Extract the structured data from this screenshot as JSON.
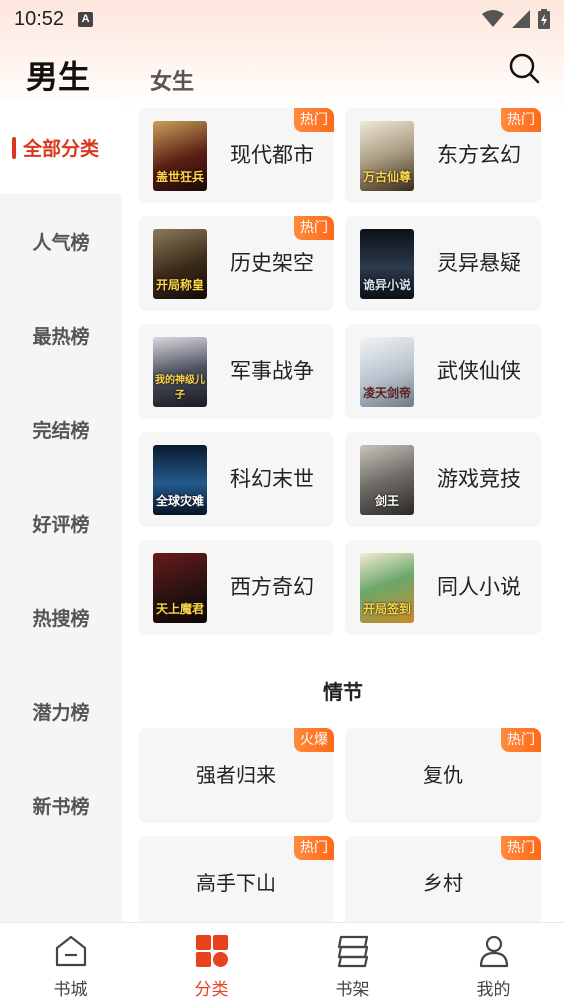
{
  "status_bar": {
    "time": "10:52",
    "notification_letter": "A"
  },
  "header": {
    "tab_male": "男生",
    "tab_female": "女生"
  },
  "sidebar": {
    "items": [
      {
        "label": "全部分类",
        "active": true
      },
      {
        "label": "人气榜"
      },
      {
        "label": "最热榜"
      },
      {
        "label": "完结榜"
      },
      {
        "label": "好评榜"
      },
      {
        "label": "热搜榜"
      },
      {
        "label": "潜力榜"
      },
      {
        "label": "新书榜"
      }
    ]
  },
  "genres": [
    {
      "title": "现代都市",
      "badge": "热门",
      "cover_text": "盖世狂兵",
      "cover_color": "#5a1e14"
    },
    {
      "title": "东方玄幻",
      "badge": "热门",
      "cover_text": "万古仙尊",
      "cover_color": "#c9c2b0"
    },
    {
      "title": "历史架空",
      "badge": "热门",
      "cover_text": "开局称皇",
      "cover_color": "#3a2a1a"
    },
    {
      "title": "灵异悬疑",
      "badge": "",
      "cover_text": "诡异小说",
      "cover_color": "#1f2630"
    },
    {
      "title": "军事战争",
      "badge": "",
      "cover_text": "我的神级儿子",
      "cover_color": "#2e2f3a"
    },
    {
      "title": "武侠仙侠",
      "badge": "",
      "cover_text": "凌天剑帝",
      "cover_color": "#d8dde2"
    },
    {
      "title": "科幻末世",
      "badge": "",
      "cover_text": "全球灾难",
      "cover_color": "#10243e"
    },
    {
      "title": "游戏竞技",
      "badge": "",
      "cover_text": "剑王",
      "cover_color": "#8d8a86"
    },
    {
      "title": "西方奇幻",
      "badge": "",
      "cover_text": "天上魔君",
      "cover_color": "#2a1212"
    },
    {
      "title": "同人小说",
      "badge": "",
      "cover_text": "开局签到",
      "cover_color": "#e8d6b0"
    }
  ],
  "plot_section": {
    "title": "情节"
  },
  "plots": [
    {
      "title": "强者归来",
      "badge": "火爆"
    },
    {
      "title": "复仇",
      "badge": "热门"
    },
    {
      "title": "高手下山",
      "badge": "热门"
    },
    {
      "title": "乡村",
      "badge": "热门"
    }
  ],
  "bottom_nav": [
    {
      "label": "书城",
      "icon": "home-icon",
      "active": false
    },
    {
      "label": "分类",
      "icon": "category-icon",
      "active": true
    },
    {
      "label": "书架",
      "icon": "bookshelf-icon",
      "active": false
    },
    {
      "label": "我的",
      "icon": "profile-icon",
      "active": false
    }
  ],
  "colors": {
    "accent": "#e8421f",
    "badge": "#ff7a2a",
    "sidebar_bg": "#f5f5f5",
    "card_bg": "#f6f6f6"
  }
}
